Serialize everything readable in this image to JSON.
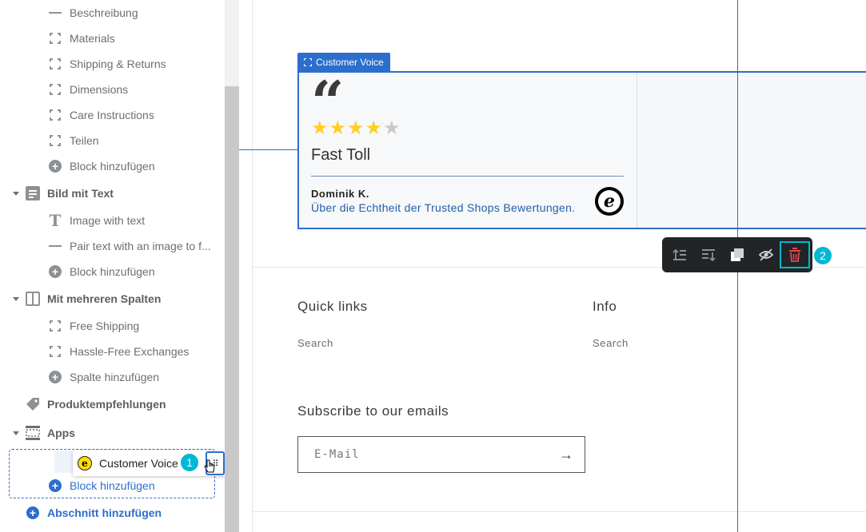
{
  "sidebar": {
    "blocks_top": [
      {
        "label": "Beschreibung",
        "icon": "text-lines-icon"
      },
      {
        "label": "Materials",
        "icon": "frame-icon"
      },
      {
        "label": "Shipping & Returns",
        "icon": "frame-icon"
      },
      {
        "label": "Dimensions",
        "icon": "frame-icon"
      },
      {
        "label": "Care Instructions",
        "icon": "frame-icon"
      },
      {
        "label": "Teilen",
        "icon": "frame-icon"
      },
      {
        "label": "Block hinzufügen",
        "icon": "plus-circle-icon"
      }
    ],
    "section_bild": {
      "label": "Bild mit Text",
      "icon": "image-text-icon"
    },
    "bild_blocks": [
      {
        "label": "Image with text",
        "icon": "text-heading-icon"
      },
      {
        "label": "Pair text with an image to f...",
        "icon": "text-lines-icon"
      },
      {
        "label": "Block hinzufügen",
        "icon": "plus-circle-icon"
      }
    ],
    "section_spalten": {
      "label": "Mit mehreren Spalten",
      "icon": "columns-icon"
    },
    "spalten_blocks": [
      {
        "label": "Free Shipping",
        "icon": "frame-icon"
      },
      {
        "label": "Hassle-Free Exchanges",
        "icon": "frame-icon"
      },
      {
        "label": "Spalte hinzufügen",
        "icon": "plus-circle-icon"
      }
    ],
    "section_produkt": {
      "label": "Produktempfehlungen",
      "icon": "tag-icon"
    },
    "section_apps": {
      "label": "Apps",
      "icon": "apps-icon"
    },
    "dragging_block": {
      "label": "Customer Voice",
      "badge": "1"
    },
    "apps_add_block": "Block hinzufügen",
    "add_section": "Abschnitt hinzufügen"
  },
  "preview": {
    "section_tag": "Customer Voice",
    "review": {
      "rating": 4,
      "max_rating": 5,
      "title": "Fast Toll",
      "author": "Dominik K.",
      "link": "Über die Echtheit der Trusted Shops Bewertungen."
    },
    "toolbar": {
      "buttons": [
        "move-up-icon",
        "move-down-icon",
        "duplicate-icon",
        "hide-icon",
        "delete-icon"
      ],
      "badge": "2"
    },
    "footer": {
      "quick_links_heading": "Quick links",
      "quick_links_item": "Search",
      "info_heading": "Info",
      "info_item": "Search",
      "subscribe_heading": "Subscribe to our emails",
      "email_placeholder": "E-Mail",
      "arrow": "→"
    }
  },
  "colors": {
    "accent": "#2c6ecb",
    "badge": "#00b8d4",
    "star": "#ffcf26",
    "delete": "#e8474f"
  }
}
